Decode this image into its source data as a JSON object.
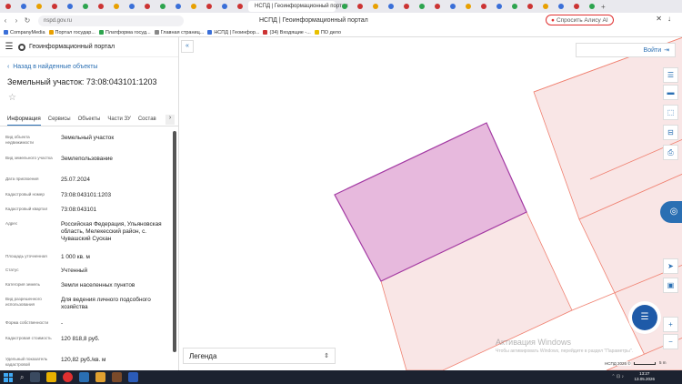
{
  "browser": {
    "active_tab_title": "НСПД | Геоинформационный портал",
    "url": "nspd.gov.ru",
    "window_title": "НСПД | Геоинформационный портал",
    "alice_label": "Спросить Алису AI",
    "bookmarks": [
      "CompanyMedia",
      "Портал государ...",
      "Платформа госуд...",
      "Главная страниц...",
      "НСПД | Геоинфор...",
      "(34) Входящие -...",
      "ПО дело"
    ],
    "colors": {
      "tab_bg": "#e9e9ee",
      "alice_border": "#e03030"
    }
  },
  "app": {
    "portal_name": "Геоинформационный портал"
  },
  "sidebar": {
    "back_label": "Назад в найденные объекты",
    "title": "Земельный участок: 73:08:043101:1203",
    "tabs": [
      "Информация",
      "Сервисы",
      "Объекты",
      "Части ЗУ",
      "Состав"
    ],
    "selected_tab": "Информация",
    "rows": [
      {
        "label": "Вид объекта недвижимости",
        "value": "Земельный участок"
      },
      {
        "label": "Вид земельного участка",
        "value": "Землепользование"
      },
      {
        "label": "Дата присвоения",
        "value": "25.07.2024"
      },
      {
        "label": "Кадастровый номер",
        "value": "73:08:043101:1203"
      },
      {
        "label": "Кадастровый квартал",
        "value": "73:08:043101"
      },
      {
        "label": "Адрес",
        "value": "Российская Федерация, Ульяновская область, Мелекесский район, с. Чувашский Сускан"
      },
      {
        "label": "Площадь уточненная",
        "value": "1 000 кв. м"
      },
      {
        "label": "Статус",
        "value": "Учтенный"
      },
      {
        "label": "Категория земель",
        "value": "Земли населенных пунктов"
      },
      {
        "label": "Вид разрешенного использования",
        "value": "Для ведения личного подсобного хозяйства"
      },
      {
        "label": "Форма собственности",
        "value": "-"
      },
      {
        "label": "Кадастровая стоимость",
        "value": "120 818,8 руб."
      },
      {
        "label": "Удельный показатель кадастровой",
        "value": "120,82 руб./кв. м"
      }
    ]
  },
  "map": {
    "login_label": "Войти",
    "legend_label": "Легенда",
    "watermark_title": "Активация Windows",
    "watermark_sub": "Чтобы активировать Windows, перейдите в раздел \"Параметры\".",
    "attribution": "НСПД 2026 ©",
    "scale_label": "5 m",
    "colors": {
      "selected_fill": "#e7b9dd",
      "selected_stroke": "#a33aa3",
      "neighbor_fill": "#f7e0e0",
      "neighbor_stroke": "#f08070",
      "accent": "#2a6fb3"
    }
  },
  "taskbar": {
    "time": "13:27",
    "date": "13.05.2026"
  }
}
